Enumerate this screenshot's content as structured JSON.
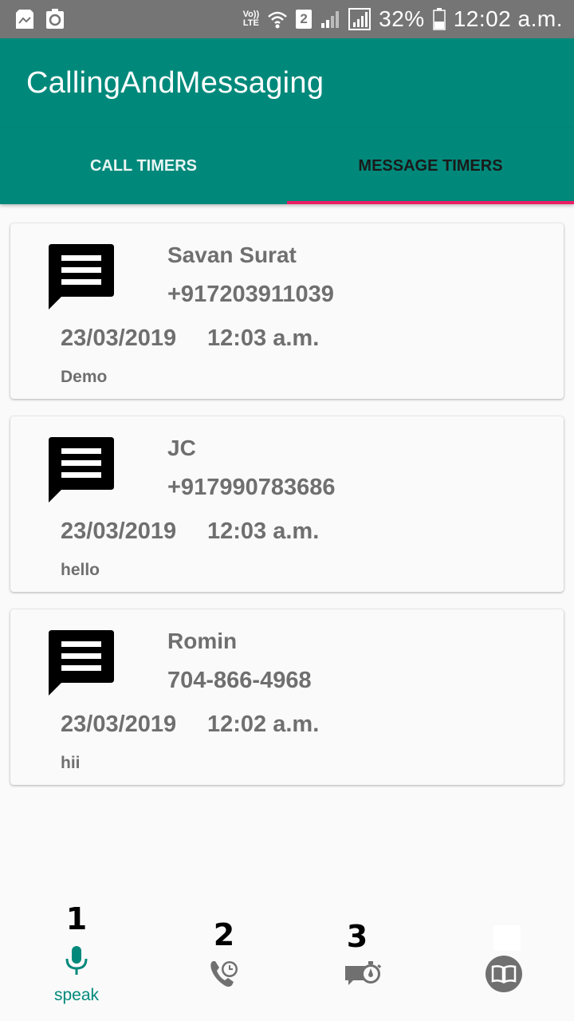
{
  "status_bar": {
    "volte_line1": "Vo))",
    "volte_line2": "LTE",
    "sim_slot": "2",
    "battery_percent": "32%",
    "time": "12:02 a.m."
  },
  "app_bar": {
    "title": "CallingAndMessaging"
  },
  "tabs": [
    {
      "label": "CALL TIMERS",
      "selected": false
    },
    {
      "label": "MESSAGE TIMERS",
      "selected": true
    }
  ],
  "messages": [
    {
      "name": "Savan Surat",
      "number": "+917203911039",
      "date": "23/03/2019",
      "time": "12:03 a.m.",
      "body": "Demo"
    },
    {
      "name": "JC",
      "number": "+917990783686",
      "date": "23/03/2019",
      "time": "12:03 a.m.",
      "body": "hello"
    },
    {
      "name": "Romin",
      "number": "704-866-4968",
      "date": "23/03/2019",
      "time": "12:02 a.m.",
      "body": "hii"
    }
  ],
  "bottom_nav": {
    "items": [
      {
        "badge": "1",
        "icon": "microphone-icon",
        "label": "speak",
        "active": true
      },
      {
        "badge": "2",
        "icon": "phone-clock-icon"
      },
      {
        "badge": "3",
        "icon": "message-timer-icon"
      },
      {
        "icon": "book-icon"
      }
    ]
  },
  "colors": {
    "primary": "#00897b",
    "accent": "#e91e63",
    "status_bar": "#757575",
    "card_text": "#6f6f6f",
    "nav_icon_inactive": "#707070"
  }
}
